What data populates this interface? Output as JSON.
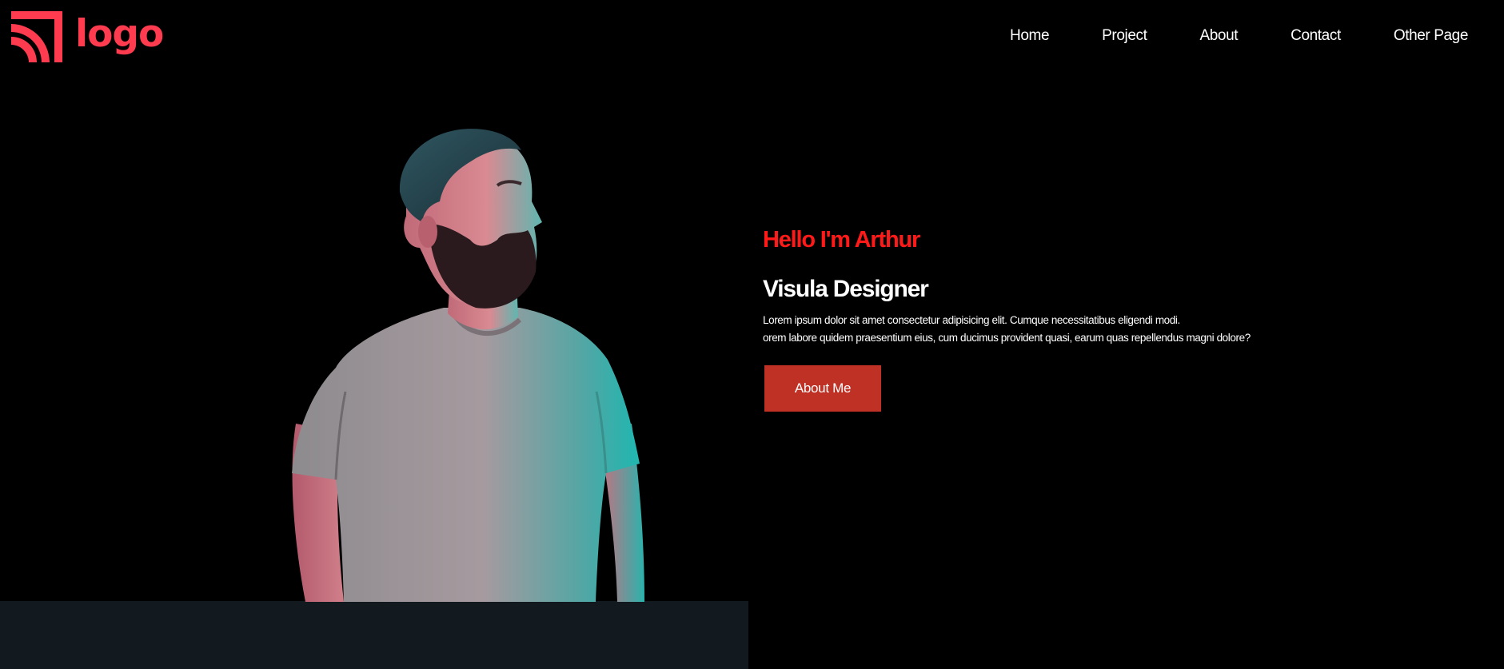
{
  "brand": {
    "logo_text": "logo",
    "accent_color": "#ff3b4f",
    "logo_icon": "rss-signal-icon"
  },
  "nav": {
    "items": [
      {
        "label": "Home"
      },
      {
        "label": "Project"
      },
      {
        "label": "About"
      },
      {
        "label": "Contact"
      },
      {
        "label": "Other Page"
      }
    ]
  },
  "hero": {
    "greeting": "Hello I'm Arthur",
    "role": "Visula Designer",
    "description_line1": "Lorem ipsum dolor sit amet consectetur adipisicing elit. Cumque necessitatibus eligendi modi.",
    "description_line2": "orem labore quidem praesentium eius, cum ducimus provident quasi, earum quas repellendus magni dolore?",
    "cta_label": "About Me",
    "cta_color": "#bf3125",
    "greeting_color": "#ff1a1a",
    "image_subject": "bearded-man-portrait"
  },
  "colors": {
    "background": "#000000",
    "bottom_band": "#131a1f"
  }
}
